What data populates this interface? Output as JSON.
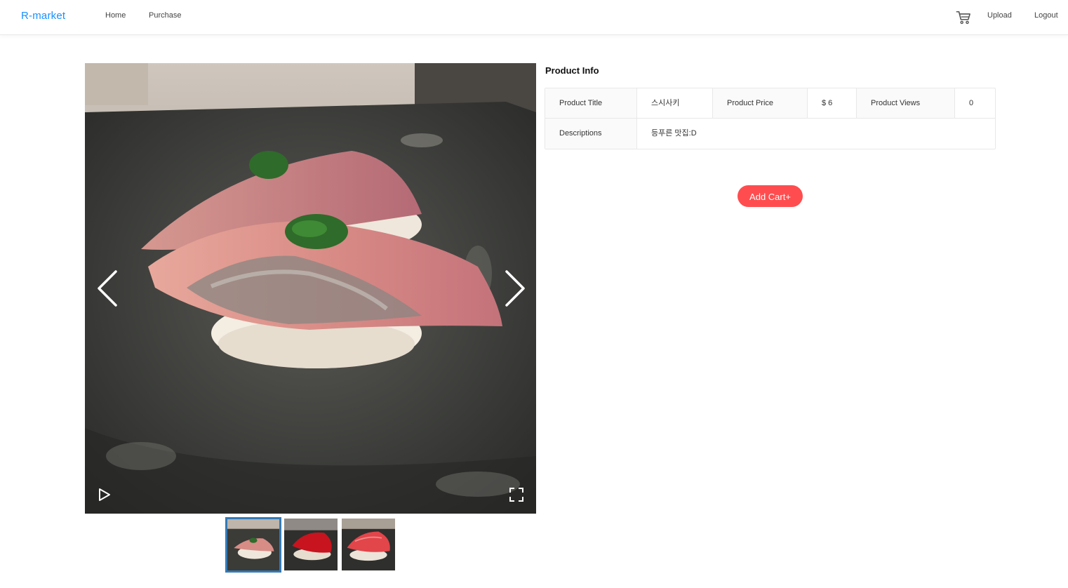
{
  "header": {
    "logo": "R-market",
    "nav_left": [
      "Home",
      "Purchase"
    ],
    "cart_icon": "shopping-cart-icon",
    "nav_right": [
      "Upload",
      "Logout"
    ],
    "link_color": "#1890ff"
  },
  "gallery": {
    "main_image_alt": "sushi-photo",
    "icons": {
      "prev": "chevron-left-icon",
      "next": "chevron-right-icon",
      "play": "play-icon",
      "fullscreen": "fullscreen-icon"
    },
    "thumbnails": [
      {
        "name": "thumbnail-1",
        "active": true
      },
      {
        "name": "thumbnail-2",
        "active": false
      },
      {
        "name": "thumbnail-3",
        "active": false
      }
    ],
    "active_border_color": "#337ab7"
  },
  "product": {
    "section_title": "Product Info",
    "title_label": "Product Title",
    "title_value": "스시사키",
    "price_label": "Product Price",
    "price_value": "$ 6",
    "views_label": "Product Views",
    "views_value": "0",
    "desc_label": "Descriptions",
    "desc_value": "등푸른 맛집:D"
  },
  "actions": {
    "add_cart_label": "Add Cart+",
    "add_cart_color": "#ff4d4f"
  }
}
